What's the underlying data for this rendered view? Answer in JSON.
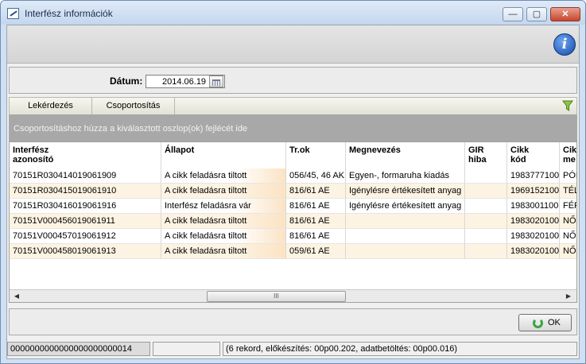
{
  "window": {
    "title": "Interfész információk",
    "controls": {
      "minimize": "—",
      "maximize": "▢",
      "close": "✕"
    }
  },
  "banner": {
    "info_icon": "i"
  },
  "date_filter": {
    "label": "Dátum:",
    "value": "2014.06.19"
  },
  "tabs": [
    {
      "label": "Lekérdezés"
    },
    {
      "label": "Csoportosítás"
    }
  ],
  "group_hint": "Csoportosításhoz húzza a kiválasztott oszlop(ok) fejlécét ide",
  "grid": {
    "columns": [
      {
        "label": "Interfész\nazonosító"
      },
      {
        "label": "Állapot"
      },
      {
        "label": "Tr.ok"
      },
      {
        "label": "Megnevezés"
      },
      {
        "label": "GIR\nhiba"
      },
      {
        "label": "Cikk\nkód"
      },
      {
        "label": "Cikk\nme"
      }
    ],
    "rows": [
      [
        "70151R030414019061909",
        "A cikk feladásra tiltott",
        "056/45, 46 AK",
        "Egyen-, formaruha kiadás",
        "",
        "1983777100",
        "PÓL"
      ],
      [
        "70151R030415019061910",
        "A cikk feladásra tiltott",
        "816/61 AE",
        "Igénylésre értékesített anyag",
        "",
        "1969152100",
        "TÉLI"
      ],
      [
        "70151R030416019061916",
        "Interfész feladásra vár",
        "816/61 AE",
        "Igénylésre értékesített anyag",
        "",
        "1983001100",
        "FÉR"
      ],
      [
        "70151V000456019061911",
        "A cikk feladásra tiltott",
        "816/61 AE",
        "",
        "",
        "1983020100",
        "NŐI"
      ],
      [
        "70151V000457019061912",
        "A cikk feladásra tiltott",
        "816/61 AE",
        "",
        "",
        "1983020100",
        "NŐI"
      ],
      [
        "70151V000458019061913",
        "A cikk feladásra tiltott",
        "059/61 AE",
        "",
        "",
        "1983020100",
        "NŐI"
      ]
    ],
    "scroll": {
      "left": "◀",
      "right": "▶",
      "thumb": "III"
    }
  },
  "footer": {
    "ok_label": "OK"
  },
  "statusbar": {
    "id": "0000000000000000000000014",
    "middle": "",
    "info": "(6 rekord, előkészítés: 00p00.202, adatbetöltés: 00p00.016)"
  },
  "colors": {
    "window_frame": "#cfe0f2",
    "group_bar": "#a8a8a8",
    "row_alt": "#fdf3e2",
    "ok_icon": "#3aa343"
  }
}
